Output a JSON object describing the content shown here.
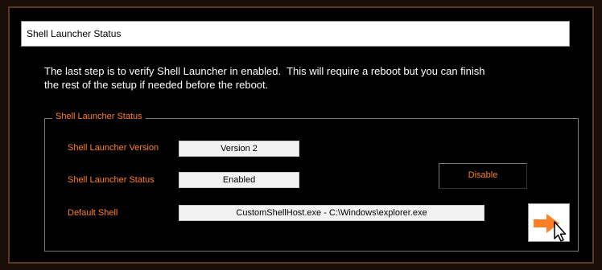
{
  "window": {
    "title": "Shell Launcher Status"
  },
  "intro": {
    "line1": "The last step is to verify Shell Launcher in enabled.  This will require a reboot but you can finish",
    "line2": "the rest of the setup if needed before the reboot."
  },
  "group": {
    "title": "Shell Launcher Status",
    "version_label": "Shell Launcher Version",
    "version_value": "Version 2",
    "status_label": "Shell Launcher Status",
    "status_value": "Enabled",
    "default_shell_label": "Default Shell",
    "default_shell_value": "CustomShellHost.exe - C:\\Windows\\explorer.exe",
    "disable_label": "Disable"
  },
  "colors": {
    "accent": "#ff7f27",
    "background": "#000000",
    "text": "#ffffff"
  },
  "icons": {
    "next": "arrow-right-icon",
    "cursor": "mouse-cursor-icon"
  }
}
